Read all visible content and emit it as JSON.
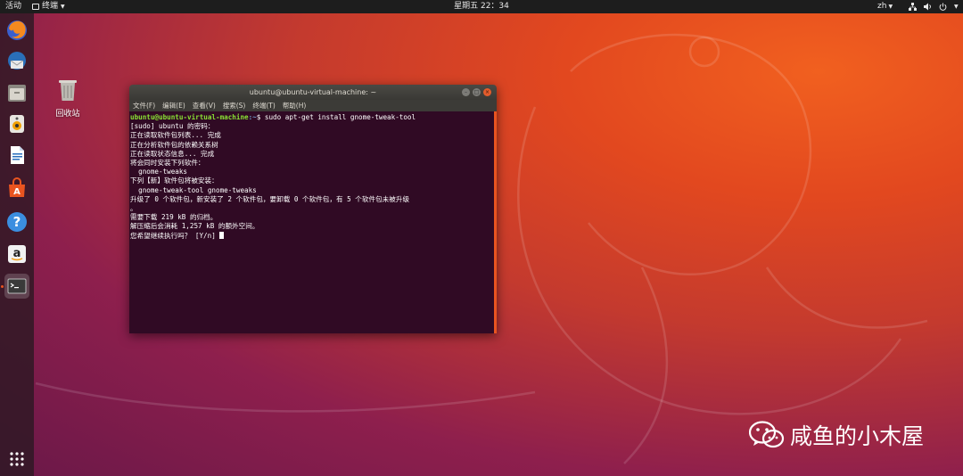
{
  "topbar": {
    "activities": "活动",
    "app_menu": "终端",
    "clock": "星期五 22：34",
    "lang": "zh"
  },
  "desktop": {
    "trash_label": "回收站"
  },
  "dock": {
    "items": [
      "firefox",
      "thunderbird",
      "files",
      "rhythmbox",
      "libreoffice-writer",
      "ubuntu-software",
      "help",
      "amazon",
      "terminal"
    ]
  },
  "terminal": {
    "title": "ubuntu@ubuntu-virtual-machine: ~",
    "menu": [
      "文件(F)",
      "编辑(E)",
      "查看(V)",
      "搜索(S)",
      "终端(T)",
      "帮助(H)"
    ],
    "prompt_user": "ubuntu@ubuntu-virtual-machine",
    "prompt_path": ":~",
    "prompt_symbol": "$ ",
    "command": "sudo apt-get install gnome-tweak-tool",
    "output": [
      "[sudo] ubuntu 的密码：",
      "正在读取软件包列表... 完成",
      "正在分析软件包的依赖关系树",
      "正在读取状态信息... 完成",
      "将会同时安装下列软件：",
      "  gnome-tweaks",
      "下列【新】软件包将被安装：",
      "  gnome-tweak-tool gnome-tweaks",
      "升级了 0 个软件包，新安装了 2 个软件包，要卸载 0 个软件包，有 5 个软件包未被升级",
      "。",
      "需要下载 219 kB 的归档。",
      "解压缩后会消耗 1,257 kB 的额外空间。"
    ],
    "last_line": "您希望继续执行吗？ [Y/n] "
  },
  "watermark": {
    "text": "咸鱼的小木屋"
  },
  "colors": {
    "accent": "#e95420",
    "terminal_bg": "#300a24",
    "prompt_green": "#8ae234",
    "prompt_blue": "#729fcf"
  }
}
